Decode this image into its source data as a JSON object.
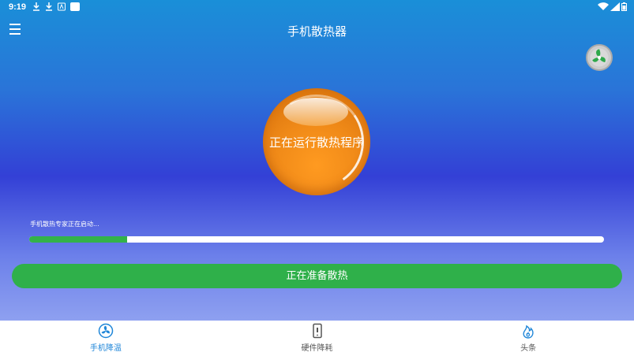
{
  "status_bar": {
    "time": "9:19"
  },
  "app_bar": {
    "title": "手机散热器"
  },
  "orb": {
    "text": "正在运行散热程序"
  },
  "progress": {
    "label": "手机散热专家正在启动...",
    "value_percent": 17
  },
  "action_button": {
    "label": "正在准备散热"
  },
  "bottom_nav": {
    "items": [
      {
        "label": "手机降温",
        "icon": "fan-icon",
        "active": true
      },
      {
        "label": "硬件降耗",
        "icon": "phone-icon",
        "active": false
      },
      {
        "label": "头条",
        "icon": "flame-icon",
        "active": false
      }
    ]
  },
  "colors": {
    "accent_blue": "#1f86d8",
    "progress_green": "#33b249",
    "button_green": "#2fb04a",
    "orb_orange": "#f08a18"
  }
}
